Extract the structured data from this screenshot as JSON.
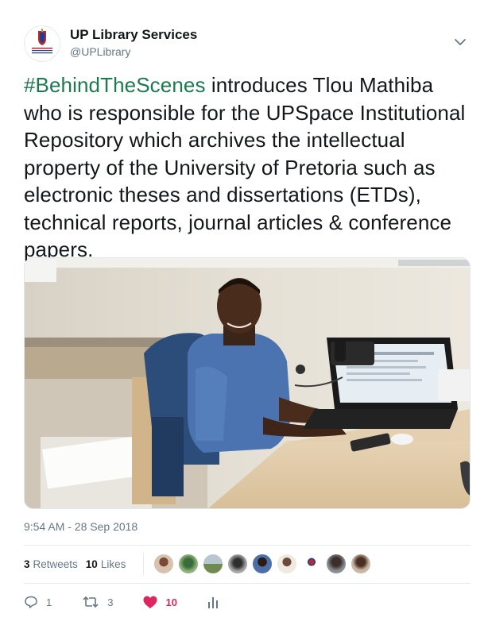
{
  "account": {
    "display_name": "UP Library Services",
    "handle": "@UPLibrary",
    "avatar_icon": "university-crest-icon"
  },
  "tweet": {
    "hashtag": "#BehindTheScenes",
    "body": " introduces Tlou Mathiba who is responsible for the UPSpace Institutional Repository which archives the intellectual property of the University of Pretoria such as electronic theses and dissertations (ETDs), technical reports, journal articles & conference papers.",
    "timestamp": "9:54 AM - 28 Sep 2018"
  },
  "stats": {
    "retweets_count": "3",
    "retweets_label": "Retweets",
    "likes_count": "10",
    "likes_label": "Likes"
  },
  "actions": {
    "reply_count": "1",
    "retweet_count": "3",
    "like_count": "10"
  },
  "colors": {
    "hashtag": "#1b7a4f",
    "like": "#e0245e",
    "secondary_text": "#657786"
  },
  "icons": [
    "chevron-down-icon",
    "reply-icon",
    "retweet-icon",
    "heart-icon",
    "analytics-icon"
  ]
}
